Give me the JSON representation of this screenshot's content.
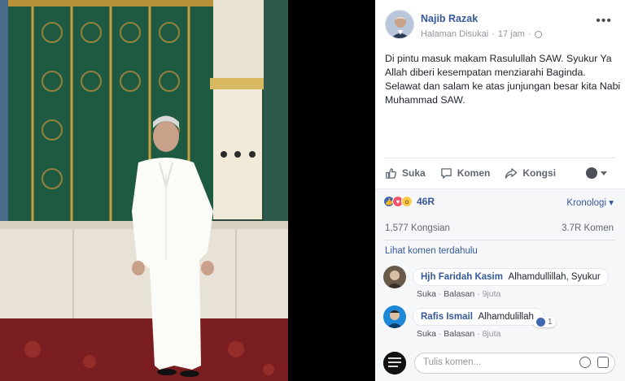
{
  "post": {
    "author": "Najib Razak",
    "page_type": "Halaman Disukai",
    "separator": "·",
    "time": "17 jam",
    "text": "Di pintu masuk makam Rasulullah SAW. Syukur Ya Allah diberi kesempatan menziarahi Baginda. Selawat dan salam ke atas junjungan besar kita Nabi Muhammad SAW."
  },
  "actions": {
    "like": "Suka",
    "comment": "Komen",
    "share": "Kongsi"
  },
  "stats": {
    "reaction_count": "46R",
    "order": "Kronologi",
    "shares": "1,577 Kongsian",
    "comments": "3.7R Komen",
    "view_previous": "Lihat komen terdahulu"
  },
  "comments": [
    {
      "name": "Hjh Faridah Kasim",
      "text": "Alhamdullillah, Syukur",
      "like": "Suka",
      "reply": "Balasan",
      "sep": "·",
      "time": "9juta"
    },
    {
      "name": "Rafis Ismail",
      "text": "Alhamdulillah.",
      "like": "Suka",
      "reply": "Balasan",
      "sep": "·",
      "time": "8juta",
      "reaction_count": "1"
    }
  ],
  "composer": {
    "placeholder": "Tulis komen..."
  },
  "icons": {
    "more": "more-icon",
    "globe": "globe-icon",
    "like": "thumbs-up-icon",
    "comment": "speech-bubble-icon",
    "share": "share-arrow-icon",
    "emoji": "emoji-icon",
    "sticker": "sticker-icon"
  },
  "colors": {
    "link": "#365899",
    "panel_bg": "#ffffff",
    "comments_bg": "#f6f7f9",
    "like_blue": "#4267b2",
    "love_red": "#f25268"
  }
}
